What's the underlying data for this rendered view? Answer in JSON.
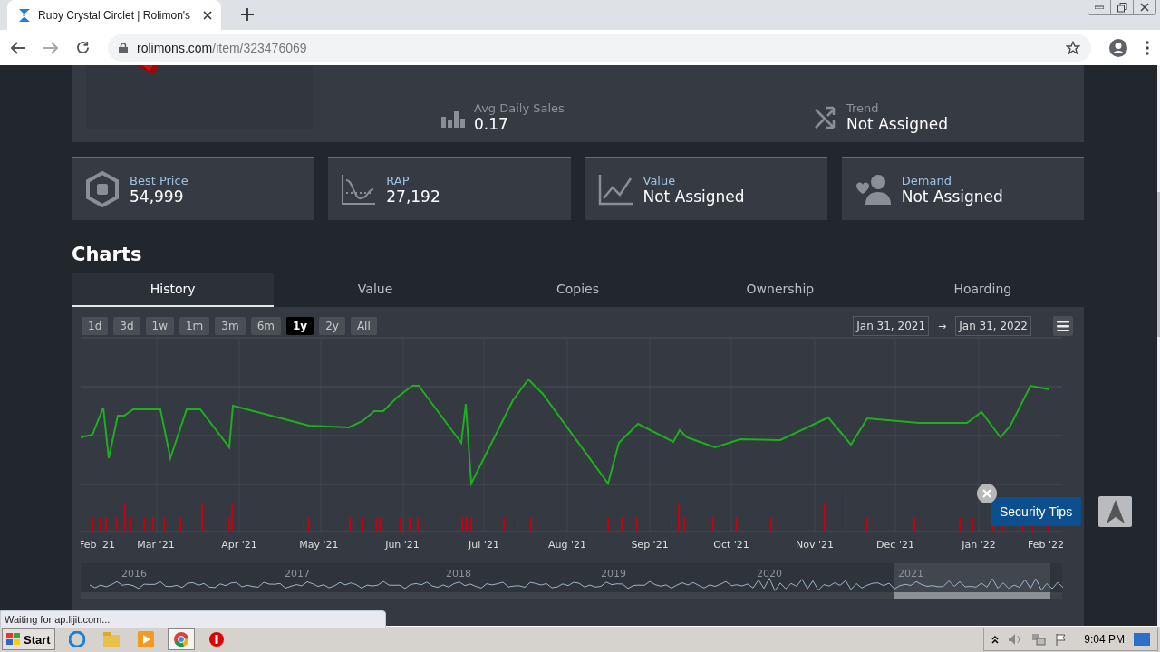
{
  "browser": {
    "tab_title": "Ruby Crystal Circlet | Rolimon's",
    "url_host": "rolimons.com",
    "url_path": "/item/323476069"
  },
  "summary": [
    {
      "kind": "sales",
      "label": "Avg Daily Sales",
      "value": "0.17"
    },
    {
      "kind": "trend",
      "label": "Trend",
      "value": "Not Assigned"
    }
  ],
  "stats": [
    {
      "kind": "price",
      "label": "Best Price",
      "value": "54,999"
    },
    {
      "kind": "rap",
      "label": "RAP",
      "value": "27,192"
    },
    {
      "kind": "value",
      "label": "Value",
      "value": "Not Assigned"
    },
    {
      "kind": "demand",
      "label": "Demand",
      "value": "Not Assigned"
    }
  ],
  "charts": {
    "heading": "Charts",
    "tabs": [
      {
        "label": "History",
        "selected": true
      },
      {
        "label": "Value",
        "selected": false
      },
      {
        "label": "Copies",
        "selected": false
      },
      {
        "label": "Ownership",
        "selected": false
      },
      {
        "label": "Hoarding",
        "selected": false
      }
    ],
    "ranges": [
      {
        "label": "1d",
        "selected": false
      },
      {
        "label": "3d",
        "selected": false
      },
      {
        "label": "1w",
        "selected": false
      },
      {
        "label": "1m",
        "selected": false
      },
      {
        "label": "3m",
        "selected": false
      },
      {
        "label": "6m",
        "selected": false
      },
      {
        "label": "1y",
        "selected": true
      },
      {
        "label": "2y",
        "selected": false
      },
      {
        "label": "All",
        "selected": false
      }
    ],
    "date_from": "Jan 31, 2021",
    "arrow": "→",
    "date_to": "Jan 31, 2022",
    "x_labels": [
      "Feb '21",
      "Mar '21",
      "Apr '21",
      "May '21",
      "Jun '21",
      "Jul '21",
      "Aug '21",
      "Sep '21",
      "Oct '21",
      "Nov '21",
      "Dec '21",
      "Jan '22",
      "Feb '22"
    ],
    "navigator_labels": [
      "2016",
      "2017",
      "2018",
      "2019",
      "2020",
      "2021"
    ]
  },
  "security_tips": "Security Tips",
  "status": "Waiting for ap.lijit.com...",
  "taskbar": {
    "start": "Start",
    "time": "9:04 PM"
  }
}
